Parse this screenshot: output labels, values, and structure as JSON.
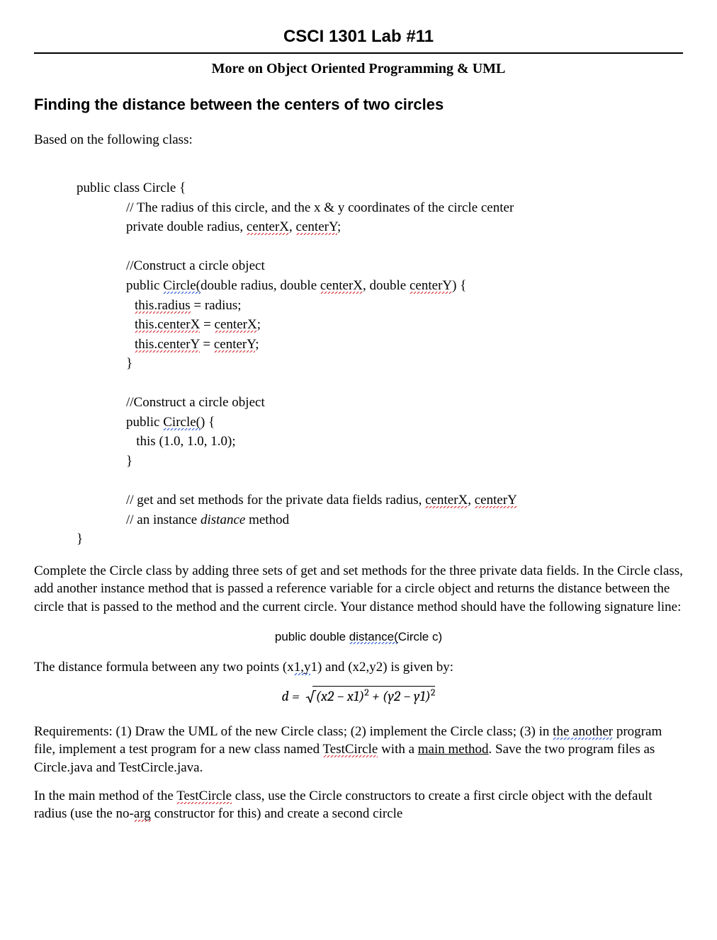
{
  "header": {
    "course_title": "CSCI 1301 Lab #11",
    "subtitle": "More on Object Oriented Programming & UML"
  },
  "section": {
    "heading": "Finding the distance between the centers of two circles",
    "intro": "Based on the following class:"
  },
  "code": {
    "l1": "public class Circle {",
    "l2a": "// The radius of this circle, and the x & y coordinates of the circle center",
    "l3a": "private double radius, ",
    "l3b": "centerX",
    "l3c": ", ",
    "l3d": "centerY",
    "l3e": ";",
    "l4": "//Construct a circle object",
    "l5a": "public ",
    "l5b": "Circle(",
    "l5c": "double radius, double ",
    "l5d": "centerX",
    "l5e": ", double ",
    "l5f": "centerY",
    "l5g": ") {",
    "l6a": "this.radius",
    "l6b": " = radius;",
    "l7a": "this.centerX",
    "l7b": " = ",
    "l7c": "centerX",
    "l7d": ";",
    "l8a": "this.centerY",
    "l8b": " = ",
    "l8c": "centerY",
    "l8d": ";",
    "l9": "}",
    "l10": "//Construct a circle object",
    "l11a": "public ",
    "l11b": "Circle(",
    "l11c": ") {",
    "l12": "   this (1.0, 1.0, 1.0);",
    "l13": "}",
    "l14a": "// get and set methods for the private data fields radius, ",
    "l14b": "centerX",
    "l14c": ", ",
    "l14d": "centerY",
    "l15a": "// an instance ",
    "l15b": "distance",
    "l15c": " method",
    "l16": "}"
  },
  "body": {
    "p1": "Complete the Circle class by adding three sets of get and set methods for the three private data fields.  In the Circle class, add another instance method that is passed a reference variable for a circle object and returns the distance between the circle that is passed to the method and the current circle. Your distance method should have the following signature line:",
    "sig_a": "public double ",
    "sig_b": "distance(",
    "sig_c": "Circle c)",
    "p2a": "The distance formula between any two points (x",
    "p2b": "1,y",
    "p2c": "1) and (x2,y2) is given by:",
    "formula_left": "d = ",
    "formula_sqrt": "(x2 − x1)",
    "formula_mid": " + (y2 − y1)",
    "p3a": "Requirements: (1) Draw the UML of the new Circle class; (2) implement the Circle class; (3) in ",
    "p3b": "the another",
    "p3c": " program file, implement a test program for a new class named ",
    "p3d": "TestCircle",
    "p3e": " with a ",
    "p3f": "main method",
    "p3g": ".  Save the two program files as Circle.java and TestCircle.java.",
    "p4a": "In the main method of the ",
    "p4b": "TestCircle",
    "p4c": " class, use the Circle constructors to create a first circle object with the default radius (use the no-",
    "p4d": "arg",
    "p4e": " constructor for this) and create a second circle"
  }
}
